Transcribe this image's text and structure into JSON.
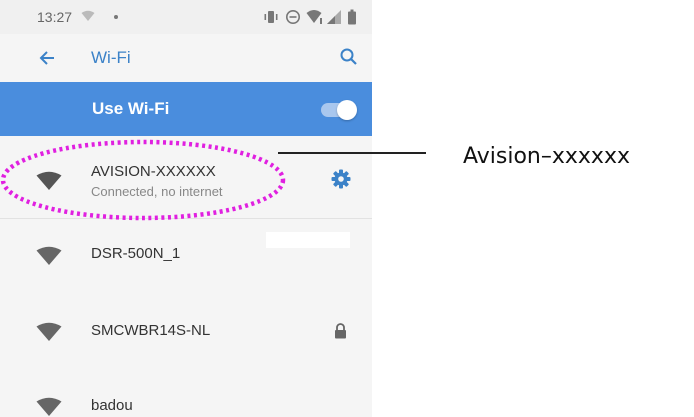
{
  "status_bar": {
    "time": "13:27"
  },
  "app_bar": {
    "title": "Wi-Fi",
    "back_icon": "back-arrow-icon",
    "search_icon": "search-icon"
  },
  "use_wifi": {
    "label": "Use Wi-Fi",
    "enabled": true
  },
  "networks": [
    {
      "name": "AVISION-XXXXXX",
      "status": "Connected, no internet",
      "icon": "wifi-full-icon",
      "action_icon": "gear-icon"
    },
    {
      "name": "DSR-500N_1",
      "status": "",
      "icon": "wifi-full-icon",
      "action_icon": ""
    },
    {
      "name": "SMCWBR14S-NL",
      "status": "",
      "icon": "wifi-full-icon",
      "action_icon": "lock-icon"
    },
    {
      "name": "badou",
      "status": "",
      "icon": "wifi-full-icon",
      "action_icon": ""
    }
  ],
  "callout": {
    "label": "Avision–xxxxxx"
  },
  "colors": {
    "accent": "#4a8ddd",
    "title_blue": "#3b82c8",
    "highlight": "#e020e0"
  }
}
